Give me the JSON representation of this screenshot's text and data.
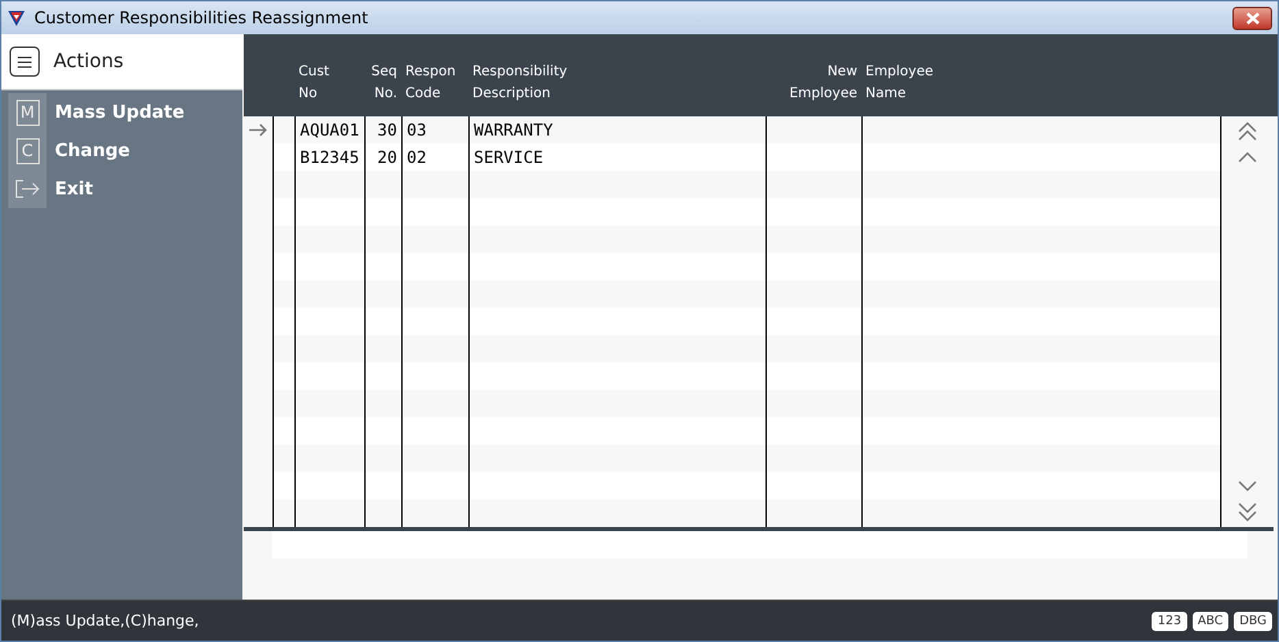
{
  "window": {
    "title": "Customer Responsibilities Reassignment"
  },
  "sidebar": {
    "title": "Actions",
    "items": [
      {
        "key": "M",
        "label": "Mass Update",
        "kind": "letter"
      },
      {
        "key": "C",
        "label": "Change",
        "kind": "letter"
      },
      {
        "label": "Exit",
        "kind": "exit"
      }
    ]
  },
  "table": {
    "columns": [
      {
        "lines": [
          "Cust",
          "No"
        ]
      },
      {
        "lines": [
          "Seq",
          "No."
        ]
      },
      {
        "lines": [
          "Respon",
          "Code"
        ]
      },
      {
        "lines": [
          "Responsibility",
          "Description"
        ]
      },
      {
        "lines": [
          "New",
          "Employee"
        ]
      },
      {
        "lines": [
          "Employee",
          "Name"
        ]
      }
    ],
    "rows": [
      {
        "selected": true,
        "cells": [
          "AQUA01",
          "30",
          "03",
          "WARRANTY"
        ]
      },
      {
        "selected": false,
        "cells": [
          "B12345",
          "20",
          "02",
          "SERVICE"
        ]
      }
    ]
  },
  "status_bar": {
    "text": "(M)ass Update,(C)hange,",
    "badges": [
      "123",
      "ABC",
      "DBG"
    ]
  }
}
